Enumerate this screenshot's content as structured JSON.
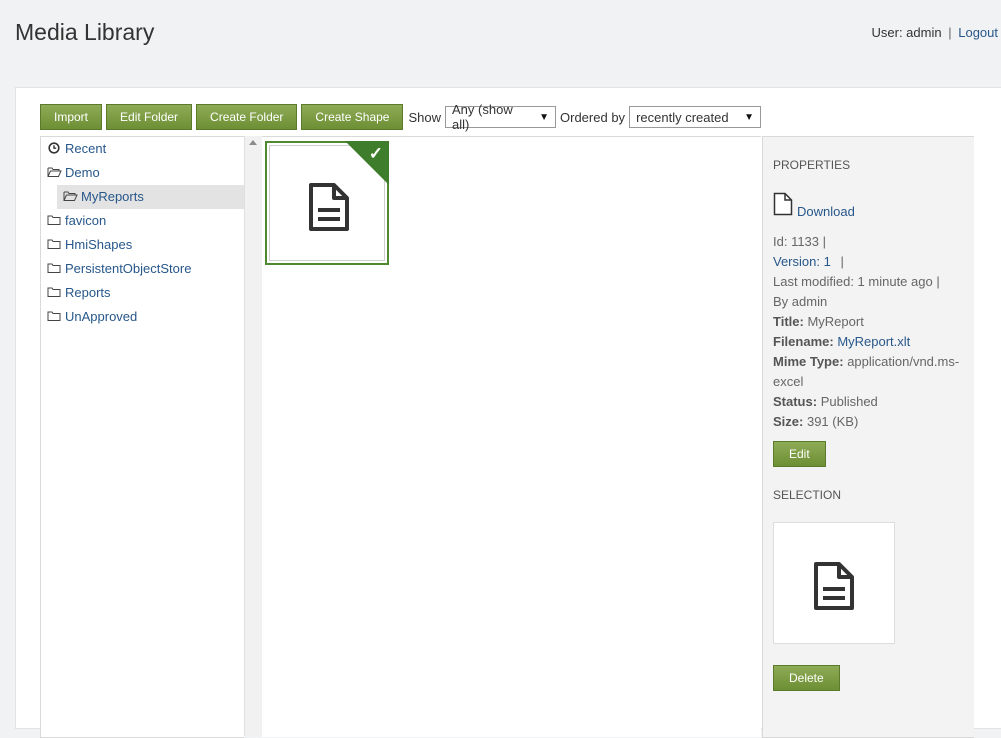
{
  "header": {
    "title": "Media Library",
    "user_label": "User: admin",
    "separator": "|",
    "logout_label": "Logout"
  },
  "toolbar": {
    "import_label": "Import",
    "edit_folder_label": "Edit Folder",
    "create_folder_label": "Create Folder",
    "create_shape_label": "Create Shape",
    "show_label": "Show",
    "show_value": "Any (show all)",
    "ordered_label": "Ordered by",
    "ordered_value": "recently created"
  },
  "tree": {
    "items": [
      {
        "label": "Recent",
        "icon": "clock-icon"
      },
      {
        "label": "Demo",
        "icon": "folder-open-icon"
      },
      {
        "label": "MyReports",
        "icon": "folder-open-icon",
        "selected": true
      },
      {
        "label": "favicon",
        "icon": "folder-icon"
      },
      {
        "label": "HmiShapes",
        "icon": "folder-icon"
      },
      {
        "label": "PersistentObjectStore",
        "icon": "folder-icon"
      },
      {
        "label": "Reports",
        "icon": "folder-icon"
      },
      {
        "label": "UnApproved",
        "icon": "folder-icon"
      }
    ]
  },
  "properties": {
    "section_title": "PROPERTIES",
    "download_label": "Download",
    "id_text": "Id: 1133 |",
    "version_label": "Version: 1",
    "version_sep": "|",
    "last_modified_text": "Last modified: 1 minute ago |",
    "by_text": "By admin",
    "title_key": "Title:",
    "title_value": "MyReport",
    "filename_key": "Filename:",
    "filename_value": "MyReport.xlt",
    "mime_key": "Mime Type:",
    "mime_value": "application/vnd.ms-excel",
    "status_key": "Status:",
    "status_value": "Published",
    "size_key": "Size:",
    "size_value": "391 (KB)",
    "edit_label": "Edit"
  },
  "selection": {
    "section_title": "SELECTION",
    "delete_label": "Delete"
  },
  "colors": {
    "button_green": "#76963d",
    "selected_border": "#4f8a30",
    "link_blue": "#27578a"
  }
}
